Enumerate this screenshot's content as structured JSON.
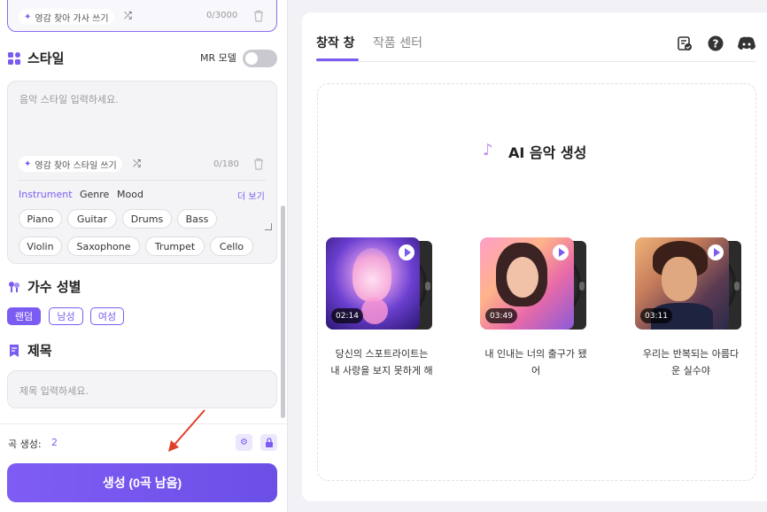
{
  "lyrics": {
    "inspire_label": "영감 찾아 가사 쓰기",
    "counter": "0/3000"
  },
  "style_section": {
    "title": "스타일",
    "mr_label": "MR 모델",
    "placeholder": "음악 스타일 입력하세요.",
    "inspire_label": "영감 찾아 스타일 쓰기",
    "counter": "0/180",
    "tabs": [
      "Instrument",
      "Genre",
      "Mood"
    ],
    "more_label": "더 보기",
    "tags_row1": [
      "Piano",
      "Guitar",
      "Drums",
      "Bass"
    ],
    "tags_row2": [
      "Violin",
      "Saxophone",
      "Trumpet",
      "Cello"
    ]
  },
  "gender_section": {
    "title": "가수 성별",
    "options": [
      "랜덤",
      "남성",
      "여성"
    ]
  },
  "title_section": {
    "title": "제목",
    "placeholder": "제목 입력하세요."
  },
  "footer": {
    "count_label": "곡 생성:",
    "count_value": "2",
    "generate_label": "생성 (0곡 남음)"
  },
  "right_panel": {
    "tabs": [
      "창작 창",
      "작품 센터"
    ],
    "ai_title": "AI 음악 생성",
    "cards": [
      {
        "duration": "02:14",
        "caption_line1": "당신의 스포트라이트는",
        "caption_line2": "내 사랑을 보지 못하게 해"
      },
      {
        "duration": "03:49",
        "caption_line1": "내 인내는 너의 출구가 됐",
        "caption_line2": "어"
      },
      {
        "duration": "03:11",
        "caption_line1": "우리는 반복되는 아름다",
        "caption_line2": "운 실수야"
      }
    ]
  },
  "colors": {
    "accent": "#7b5cf2",
    "arrow": "#e0402a"
  }
}
